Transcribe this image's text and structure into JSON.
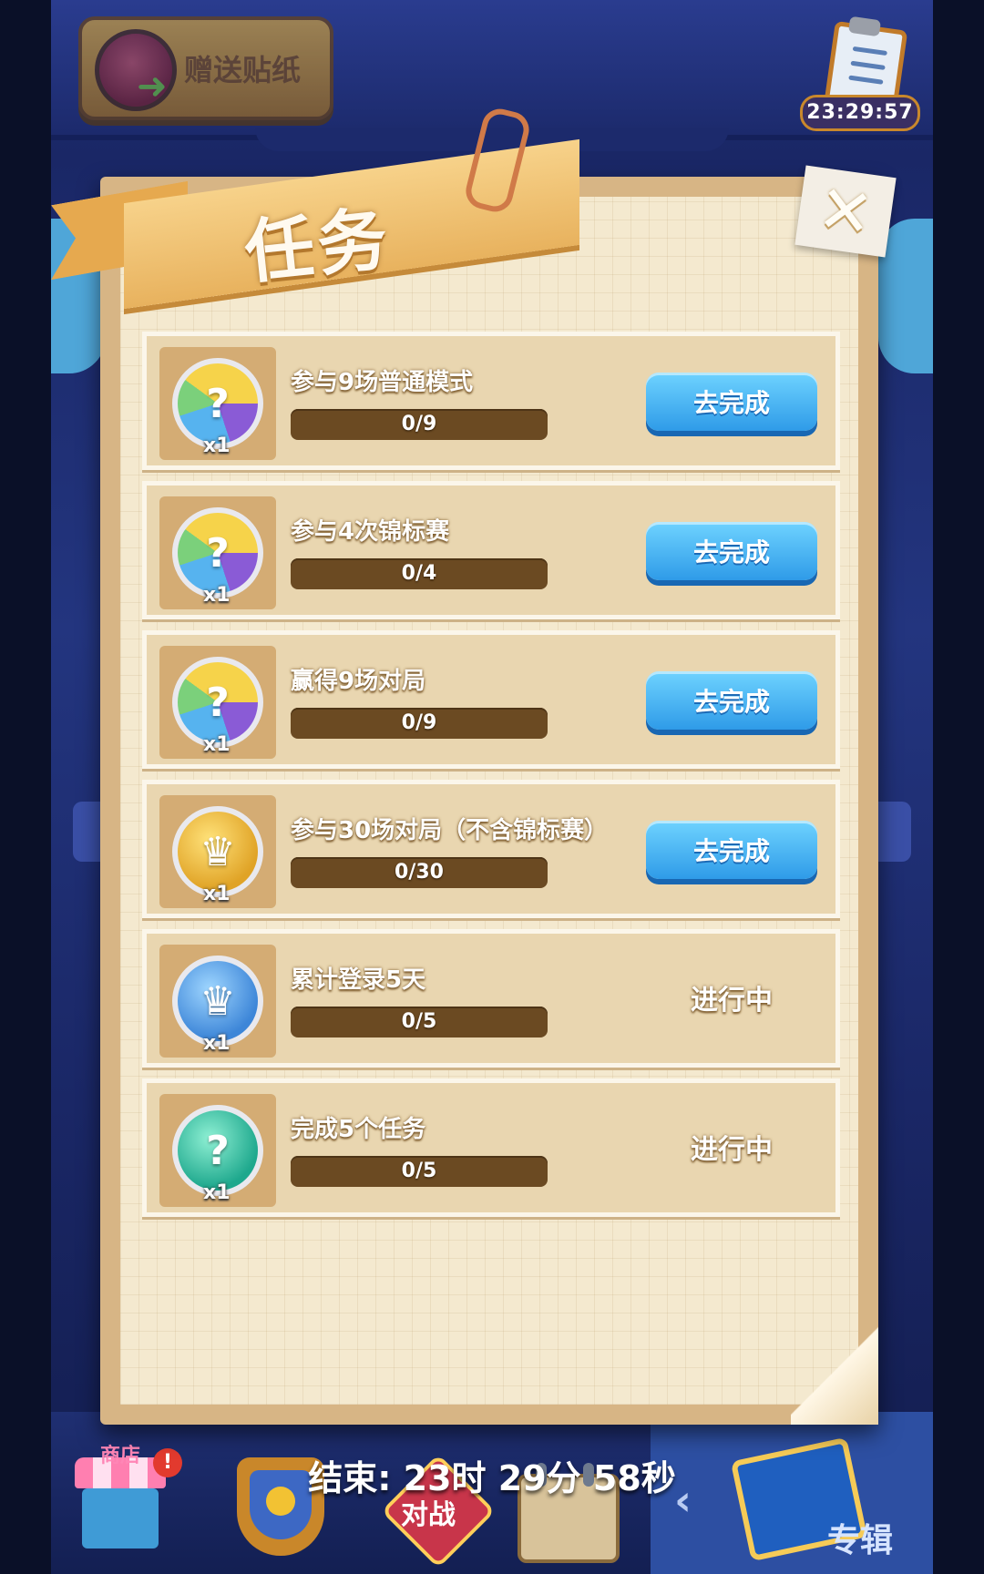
{
  "topbar": {
    "gift_sticker_label": "赠送贴纸",
    "task_timer": "23:29:57"
  },
  "panel": {
    "title": "任务",
    "close_symbol": "✕"
  },
  "tasks": [
    {
      "title": "参与9场普通模式",
      "progress_text": "0/9",
      "progress": 0,
      "reward_qty": "x1",
      "sticker": "rainbow-mystery-sticker",
      "action": "去完成",
      "status": ""
    },
    {
      "title": "参与4次锦标赛",
      "progress_text": "0/4",
      "progress": 0,
      "reward_qty": "x1",
      "sticker": "rainbow-mystery-sticker",
      "action": "去完成",
      "status": ""
    },
    {
      "title": "赢得9场对局",
      "progress_text": "0/9",
      "progress": 0,
      "reward_qty": "x1",
      "sticker": "rainbow-mystery-sticker",
      "action": "去完成",
      "status": ""
    },
    {
      "title": "参与30场对局（不含锦标赛）",
      "progress_text": "0/30",
      "progress": 0,
      "reward_qty": "x1",
      "sticker": "gold-crown-sticker",
      "action": "去完成",
      "status": ""
    },
    {
      "title": "累计登录5天",
      "progress_text": "0/5",
      "progress": 0,
      "reward_qty": "x1",
      "sticker": "blue-crown-sticker",
      "action": "",
      "status": "进行中"
    },
    {
      "title": "完成5个任务",
      "progress_text": "0/5",
      "progress": 0,
      "reward_qty": "x1",
      "sticker": "teal-mystery-sticker",
      "action": "",
      "status": "进行中"
    }
  ],
  "footer": {
    "countdown": "结束: 23时 29分 58秒"
  },
  "bottom_nav": {
    "shop_tag": "商店",
    "shop_badge": "!",
    "cube_text": "对战",
    "album_label": "专辑",
    "back_arrow": "‹"
  },
  "colors": {
    "action_button": "#2f9be8",
    "progress_track": "#6b4a22",
    "panel_paper": "#f4e9cf",
    "ribbon": "#e8b25e"
  }
}
